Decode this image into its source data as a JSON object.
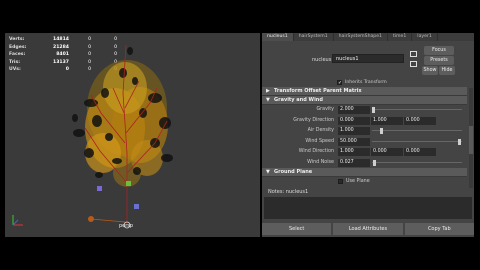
{
  "hud": {
    "rows": [
      {
        "label": "Verts:",
        "v1": "14814",
        "v2": "0",
        "v3": "0"
      },
      {
        "label": "Edges:",
        "v1": "21284",
        "v2": "0",
        "v3": "0"
      },
      {
        "label": "Faces:",
        "v1": "8401",
        "v2": "0",
        "v3": "0"
      },
      {
        "label": "Tris:",
        "v1": "13137",
        "v2": "0",
        "v3": "0"
      },
      {
        "label": "UVs:",
        "v1": "0",
        "v2": "0",
        "v3": "0"
      }
    ]
  },
  "viewport": {
    "camera_label": "persp"
  },
  "tabs": [
    "nucleus1",
    "hairSystem1",
    "hairSystemShape1",
    "time1",
    "layer1"
  ],
  "node": {
    "label": "nucleus:",
    "value": "nucleus1",
    "focus_label": "Focus",
    "presets_label": "Presets",
    "show_label": "Show",
    "hide_label": "Hide"
  },
  "inherits_label": "Inherits Transform",
  "sections": {
    "transform": "Transform Attributes",
    "offset": "Transform Offset Parent Matrix",
    "gravity": "Gravity and Wind",
    "ground": "Ground Plane"
  },
  "attrs": {
    "gravity": {
      "label": "Gravity",
      "value": "2.000"
    },
    "gravity_dir": {
      "label": "Gravity Direction",
      "x": "0.000",
      "y": "1.000",
      "z": "0.000"
    },
    "air_density": {
      "label": "Air Density",
      "value": "1.000"
    },
    "wind_speed": {
      "label": "Wind Speed",
      "value": "50.000"
    },
    "wind_dir": {
      "label": "Wind Direction",
      "x": "1.000",
      "y": "0.000",
      "z": "0.000"
    },
    "wind_noise": {
      "label": "Wind Noise",
      "value": "0.027"
    }
  },
  "use_plane_label": "Use Plane",
  "notes_label": "Notes:  nucleus1",
  "buttons": {
    "select": "Select",
    "load": "Load Attributes",
    "copy": "Copy Tab"
  }
}
